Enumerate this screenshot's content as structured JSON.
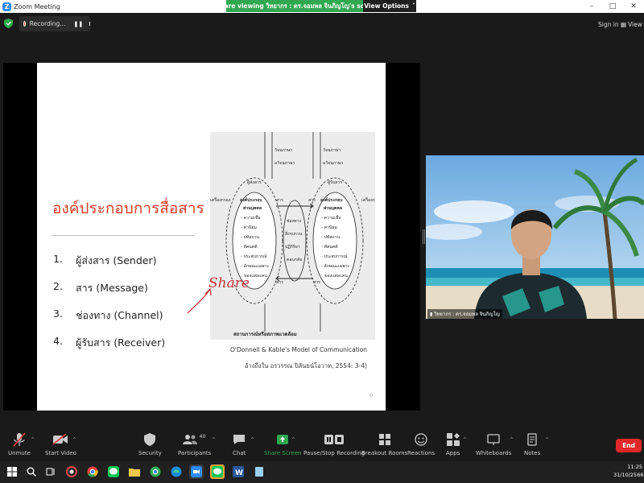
{
  "window": {
    "title": "Zoom Meeting"
  },
  "banner": {
    "message": "You are viewing วิทยากร : ดร.จอมพล จินภิญโญ's screen",
    "view_options": "View Options"
  },
  "recording": {
    "label": "Recording..."
  },
  "topbar": {
    "sign_in": "Sign in",
    "view": "View"
  },
  "slide": {
    "title": "องค์ประกอบการสื่อสาร",
    "items": [
      {
        "num": "1.",
        "text": "ผู้ส่งสาร (Sender)"
      },
      {
        "num": "2.",
        "text": "สาร (Message)"
      },
      {
        "num": "3.",
        "text": "ช่องทาง (Channel)"
      },
      {
        "num": "4.",
        "text": "ผู้รับสาร (Receiver)"
      }
    ],
    "diagram": {
      "top_labels_left": [
        "วัจนภาษา",
        "อวัจนภาษา"
      ],
      "top_labels_right": [
        "วัจนภาษา",
        "อวัจนภาษา"
      ],
      "sender": "ผู้ส่งสาร",
      "receiver": "ผู้รับสาร",
      "filter": "เครื่องกรอง",
      "message": "สาร",
      "box_title": "องค์ประกอบ",
      "box_subtitle": "ส่วนบุคคล",
      "box_items": [
        "- ความเชื่อ",
        "- ค่านิยม",
        "- ปทัสถาน",
        "- ทัศนคติ",
        "- ประสบการณ์",
        "- ลักษณะเฉพาะ",
        "ของแต่ละคน"
      ],
      "middle": [
        "ช่องทาง",
        "สิ่งรบกวน",
        "ปฏิกิริยา",
        "ตอบกลับ"
      ],
      "context": "สถานการณ์หรือสภาพแวดล้อม"
    },
    "caption_model": "O'Donnell & Kable's Model of Communication",
    "caption_ref": "อ้างถึงใน อรวรรณ ปิลันธน์โอวาท, 2554: 3-4)",
    "annotation": "Share"
  },
  "video": {
    "name": "วิทยากร : ดร.จอมพล จินภิญโญ"
  },
  "toolbar": {
    "unmute": "Unmute",
    "start_video": "Start Video",
    "security": "Security",
    "participants": "Participants",
    "participants_count": "40",
    "chat": "Chat",
    "share_screen": "Share Screen",
    "pause_recording": "Pause/Stop Recording",
    "breakout": "Breakout Rooms",
    "reactions": "Reactions",
    "apps": "Apps",
    "whiteboards": "Whiteboards",
    "notes": "Notes",
    "end": "End"
  },
  "taskbar": {
    "time": "11:25",
    "date": "31/10/2566"
  },
  "colors": {
    "accent_green": "#2fa84f",
    "end_red": "#e02828",
    "title_red": "#d9412a",
    "zoom_blue": "#2d8cff"
  }
}
